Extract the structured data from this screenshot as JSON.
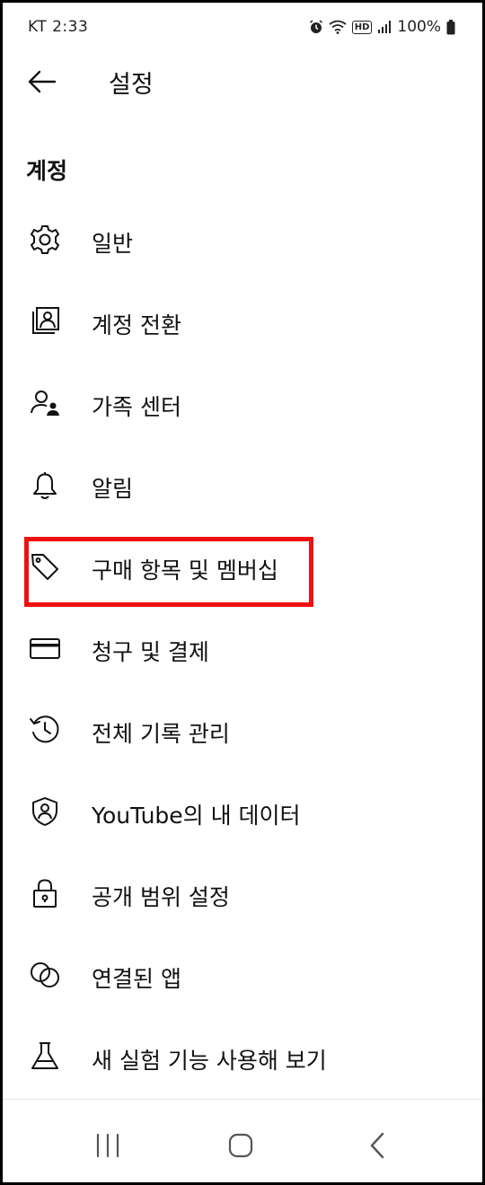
{
  "status_bar": {
    "carrier_time": "KT 2:33",
    "battery": "100%",
    "hd_badge": "HD",
    "icons": [
      "alarm-icon",
      "wifi-icon",
      "hd-icon",
      "signal-icon",
      "battery-icon"
    ]
  },
  "header": {
    "title": "설정",
    "back_icon": "arrow-left-icon"
  },
  "section": {
    "title": "계정"
  },
  "menu": {
    "items": [
      {
        "label": "일반",
        "icon": "gear-icon"
      },
      {
        "label": "계정 전환",
        "icon": "account-switch-icon"
      },
      {
        "label": "가족 센터",
        "icon": "family-icon"
      },
      {
        "label": "알림",
        "icon": "bell-icon"
      },
      {
        "label": "구매 항목 및 멤버십",
        "icon": "tag-icon",
        "highlighted": true
      },
      {
        "label": "청구 및 결제",
        "icon": "credit-card-icon"
      },
      {
        "label": "전체 기록 관리",
        "icon": "history-icon"
      },
      {
        "label": "YouTube의 내 데이터",
        "icon": "shield-person-icon"
      },
      {
        "label": "공개 범위 설정",
        "icon": "lock-icon"
      },
      {
        "label": "연결된 앱",
        "icon": "linked-circles-icon"
      },
      {
        "label": "새 실험 기능 사용해 보기",
        "icon": "flask-icon"
      }
    ]
  },
  "colors": {
    "highlight": "#ee1111",
    "text": "#111111",
    "background": "#ffffff"
  },
  "nav_bar": {
    "buttons": [
      "recent-apps-icon",
      "home-icon",
      "back-icon"
    ]
  }
}
